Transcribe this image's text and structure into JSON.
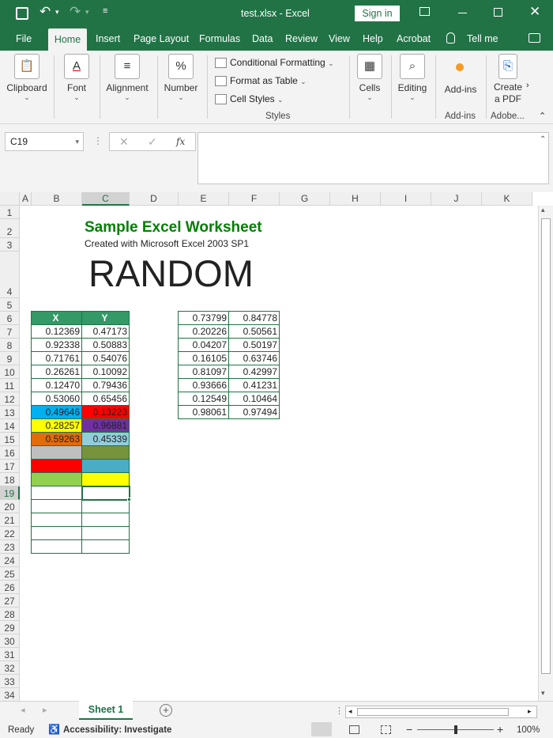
{
  "titlebar": {
    "title": "test.xlsx  -  Excel",
    "sign_in": "Sign in"
  },
  "tabs": [
    "File",
    "Home",
    "Insert",
    "Page Layout",
    "Formulas",
    "Data",
    "Review",
    "View",
    "Help",
    "Acrobat",
    "Tell me"
  ],
  "active_tab": "Home",
  "ribbon": {
    "clipboard": "Clipboard",
    "font": "Font",
    "alignment": "Alignment",
    "number": "Number",
    "number_icon": "%",
    "styles_items": [
      "Conditional Formatting",
      "Format as Table",
      "Cell Styles"
    ],
    "styles_group": "Styles",
    "cells": "Cells",
    "editing": "Editing",
    "addins": "Add-ins",
    "addins_group": "Add-ins",
    "create_pdf_line1": "Create",
    "create_pdf_line2": "a PDF",
    "adobe_group": "Adobe..."
  },
  "formula_bar": {
    "name_box": "C19",
    "fx": "fx",
    "formula": ""
  },
  "columns": [
    "A",
    "B",
    "C",
    "D",
    "E",
    "F",
    "G",
    "H",
    "I",
    "J",
    "K"
  ],
  "rows": [
    "1",
    "2",
    "3",
    "4",
    "5",
    "6",
    "7",
    "8",
    "9",
    "10",
    "11",
    "12",
    "13",
    "14",
    "15",
    "16",
    "17",
    "18",
    "19",
    "20",
    "21",
    "22",
    "23",
    "24",
    "25",
    "26",
    "27",
    "28",
    "29",
    "30",
    "31",
    "32",
    "33",
    "34"
  ],
  "selected": {
    "cell": "C19",
    "column": "C",
    "row": "19"
  },
  "sheet_text": {
    "title": "Sample Excel Worksheet",
    "subtitle": "Created with Microsoft Excel 2003 SP1",
    "random": "RANDOM"
  },
  "table1": {
    "headers": [
      "X",
      "Y"
    ],
    "rows": [
      [
        "0.12369",
        "0.47173"
      ],
      [
        "0.92338",
        "0.50883"
      ],
      [
        "0.71761",
        "0.54076"
      ],
      [
        "0.26261",
        "0.10092"
      ],
      [
        "0.12470",
        "0.79436"
      ],
      [
        "0.53060",
        "0.65456"
      ],
      [
        "0.49646",
        "0.13223"
      ],
      [
        "0.28257",
        "0.96881"
      ],
      [
        "0.59263",
        "0.45339"
      ]
    ],
    "colors": [
      [
        "#ffffff",
        "#ffffff"
      ],
      [
        "#ffffff",
        "#ffffff"
      ],
      [
        "#ffffff",
        "#ffffff"
      ],
      [
        "#ffffff",
        "#ffffff"
      ],
      [
        "#ffffff",
        "#ffffff"
      ],
      [
        "#ffffff",
        "#ffffff"
      ],
      [
        "#00b0f0",
        "#ff0000"
      ],
      [
        "#ffff00",
        "#7030a0"
      ],
      [
        "#e26b0a",
        "#92cddc"
      ],
      [
        "#bfbfbf",
        "#77933c"
      ],
      [
        "#ff0000",
        "#4bacc6"
      ],
      [
        "#92d050",
        "#ffff00"
      ]
    ]
  },
  "table2": {
    "rows": [
      [
        "0.73799",
        "0.84778"
      ],
      [
        "0.20226",
        "0.50561"
      ],
      [
        "0.04207",
        "0.50197"
      ],
      [
        "0.16105",
        "0.63746"
      ],
      [
        "0.81097",
        "0.42997"
      ],
      [
        "0.93666",
        "0.41231"
      ],
      [
        "0.12549",
        "0.10464"
      ],
      [
        "0.98061",
        "0.97494"
      ]
    ]
  },
  "sheet_tab": "Sheet 1",
  "status": {
    "ready": "Ready",
    "accessibility": "Accessibility: Investigate",
    "zoom": "100%"
  },
  "colors": {
    "excel_green": "#217346",
    "header_green": "#339966",
    "title_green": "#008000"
  }
}
